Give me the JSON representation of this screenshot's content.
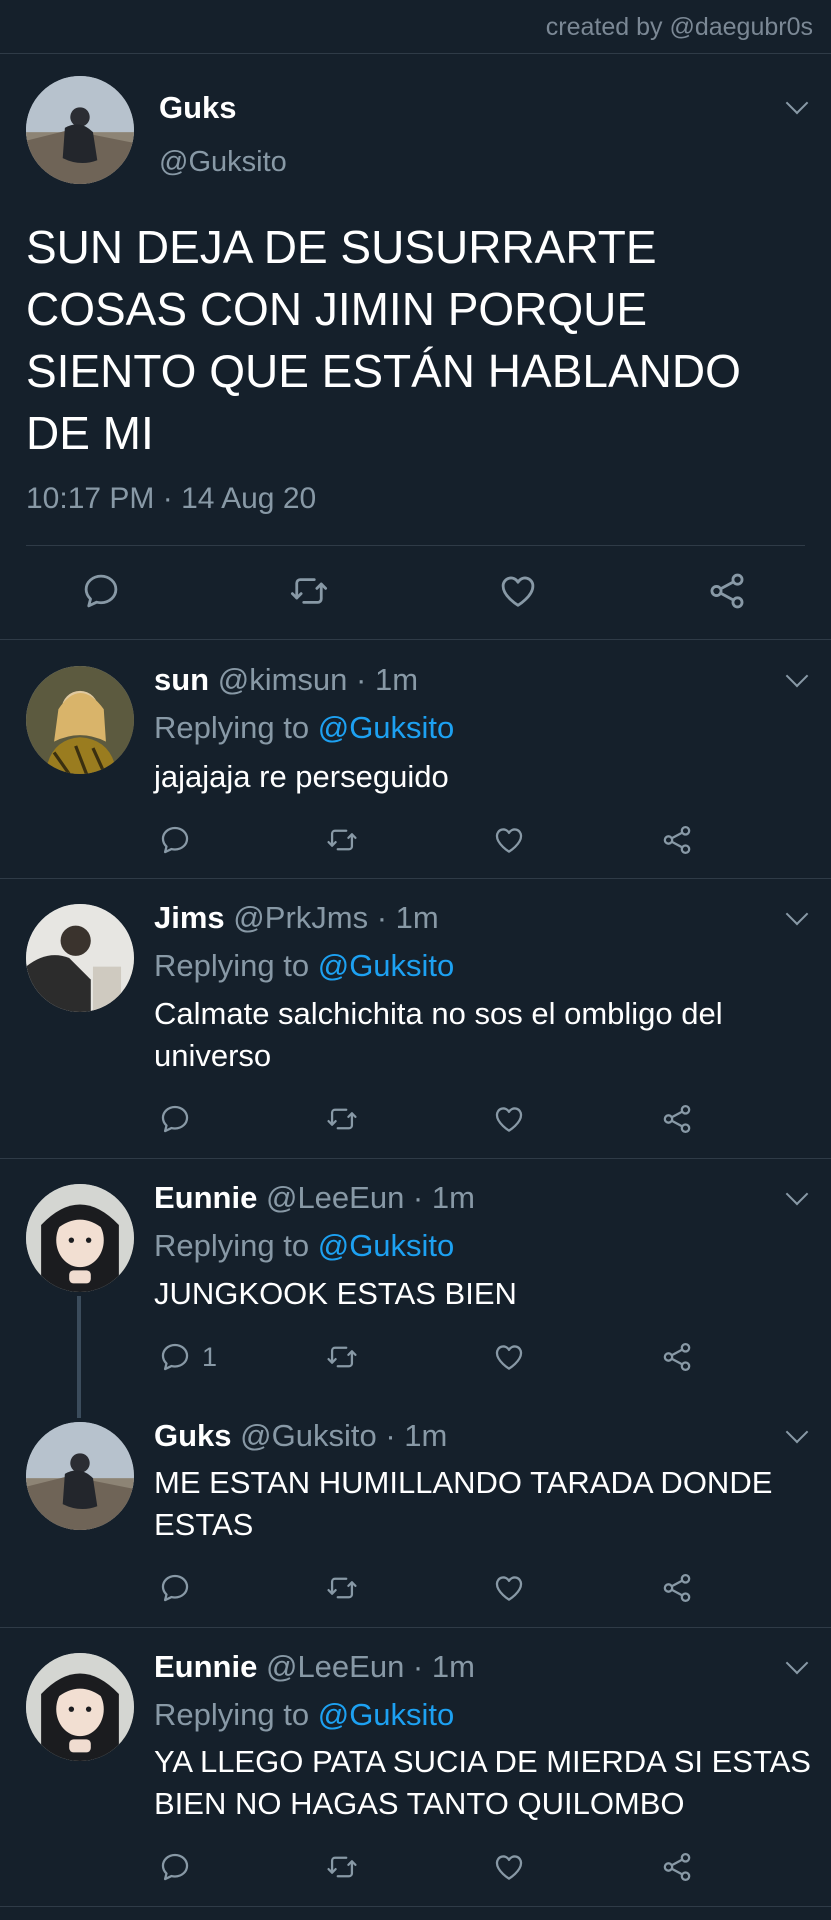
{
  "credit": "created by @daegubr0s",
  "main": {
    "name": "Guks",
    "handle": "@Guksito",
    "text": "SUN DEJA DE SUSURRARTE COSAS CON JIMIN PORQUE SIENTO QUE ESTÁN HABLANDO DE MI",
    "time": "10:17 PM · 14 Aug 20"
  },
  "replies": [
    {
      "name": "sun",
      "handle": "@kimsun · 1m",
      "replying_prefix": "Replying to ",
      "replying_to": "@Guksito",
      "text": "jajajaja re perseguido",
      "reply_count": ""
    },
    {
      "name": "Jims",
      "handle": "@PrkJms · 1m",
      "replying_prefix": "Replying to ",
      "replying_to": "@Guksito",
      "text": "Calmate salchichita no sos el ombligo del universo",
      "reply_count": ""
    },
    {
      "name": "Eunnie",
      "handle": "@LeeEun · 1m",
      "replying_prefix": "Replying to ",
      "replying_to": "@Guksito",
      "text": "JUNGKOOK ESTAS BIEN",
      "reply_count": "1"
    },
    {
      "name": "Guks",
      "handle": "@Guksito · 1m",
      "text": "ME ESTAN HUMILLANDO TARADA DONDE ESTAS",
      "reply_count": ""
    },
    {
      "name": "Eunnie",
      "handle": "@LeeEun · 1m",
      "replying_prefix": "Replying to ",
      "replying_to": "@Guksito",
      "text": "YA LLEGO PATA SUCIA DE MIERDA SI ESTAS BIEN NO HAGAS TANTO QUILOMBO",
      "reply_count": ""
    }
  ],
  "colors": {
    "background": "#15202b",
    "secondary_text": "#8899a6",
    "link": "#1da1f2",
    "divider": "#2f3b47"
  },
  "icons": [
    "reply-icon",
    "retweet-icon",
    "like-icon",
    "share-icon",
    "chevron-down-icon"
  ]
}
